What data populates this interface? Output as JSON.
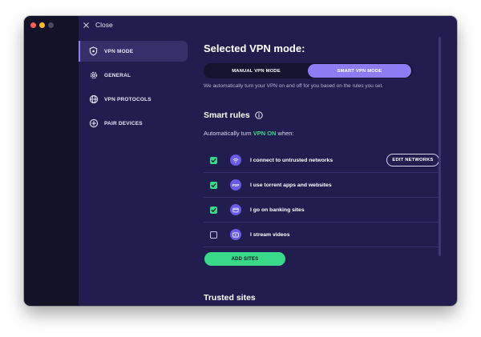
{
  "window": {
    "close_label": "Close"
  },
  "sidebar": {
    "items": [
      {
        "label": "VPN MODE",
        "icon": "shield-icon",
        "active": true
      },
      {
        "label": "GENERAL",
        "icon": "gear-icon",
        "active": false
      },
      {
        "label": "VPN PROTOCOLS",
        "icon": "globe-icon",
        "active": false
      },
      {
        "label": "PAIR DEVICES",
        "icon": "plus-circle-icon",
        "active": false
      }
    ]
  },
  "main": {
    "title": "Selected VPN mode:",
    "modes": {
      "manual": "MANUAL VPN MODE",
      "smart": "SMART VPN MODE",
      "selected": "smart"
    },
    "description": "We automatically turn your VPN on and off for you based on the rules you set.",
    "smart_rules": {
      "title": "Smart rules",
      "sub_prefix": "Automatically turn ",
      "sub_highlight": "VPN ON",
      "sub_suffix": " when:",
      "rules": [
        {
          "label": "I connect to untrusted networks",
          "checked": true,
          "icon": "wifi-icon"
        },
        {
          "label": "I use torrent apps and websites",
          "checked": true,
          "icon": "p2p-icon",
          "icon_text": "P2P"
        },
        {
          "label": "I go on banking sites",
          "checked": true,
          "icon": "wallet-icon"
        },
        {
          "label": "I stream videos",
          "checked": false,
          "icon": "video-icon"
        }
      ],
      "edit_networks": "EDIT NETWORKS",
      "add_sites": "ADD SITES"
    },
    "trusted_title": "Trusted sites"
  },
  "colors": {
    "background": "#211d4e",
    "sidebar": "#131228",
    "accent_purple": "#8d7df5",
    "accent_green": "#39d98a"
  }
}
